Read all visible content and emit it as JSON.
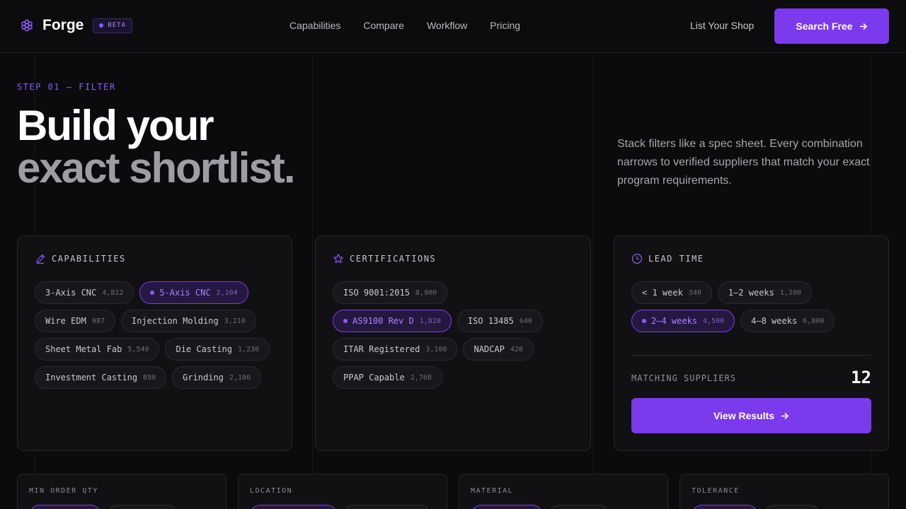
{
  "nav": {
    "brand": "Forge",
    "badge": "BETA",
    "links": [
      "Capabilities",
      "Compare",
      "Workflow",
      "Pricing"
    ],
    "list_shop": "List Your Shop",
    "search_btn": "Search Free"
  },
  "hero": {
    "eyebrow": "STEP 01 — FILTER",
    "title_line1": "Build your",
    "title_line2": "exact shortlist.",
    "description": "Stack filters like a spec sheet. Every combination narrows to verified suppliers that match your exact program requirements."
  },
  "capabilities": {
    "title": "CAPABILITIES",
    "chips": [
      {
        "label": "3-Axis CNC",
        "count": "4,812",
        "active": false
      },
      {
        "label": "5-Axis CNC",
        "count": "2,104",
        "active": true
      },
      {
        "label": "Wire EDM",
        "count": "987",
        "active": false
      },
      {
        "label": "Injection Molding",
        "count": "3,210",
        "active": false
      },
      {
        "label": "Sheet Metal Fab",
        "count": "5,540",
        "active": false
      },
      {
        "label": "Die Casting",
        "count": "1,230",
        "active": false
      },
      {
        "label": "Investment Casting",
        "count": "890",
        "active": false
      },
      {
        "label": "Grinding",
        "count": "2,100",
        "active": false
      }
    ]
  },
  "certifications": {
    "title": "CERTIFICATIONS",
    "chips": [
      {
        "label": "ISO 9001:2015",
        "count": "8,900",
        "active": false
      },
      {
        "label": "AS9100 Rev D",
        "count": "1,820",
        "active": true
      },
      {
        "label": "ISO 13485",
        "count": "640",
        "active": false
      },
      {
        "label": "ITAR Registered",
        "count": "3,100",
        "active": false
      },
      {
        "label": "NADCAP",
        "count": "420",
        "active": false
      },
      {
        "label": "PPAP Capable",
        "count": "2,760",
        "active": false
      }
    ]
  },
  "lead_time": {
    "title": "LEAD TIME",
    "chips": [
      {
        "label": "< 1 week",
        "count": "340",
        "active": false
      },
      {
        "label": "1–2 weeks",
        "count": "1,200",
        "active": false
      },
      {
        "label": "2–4 weeks",
        "count": "4,500",
        "active": true
      },
      {
        "label": "4–8 weeks",
        "count": "6,800",
        "active": false
      }
    ],
    "matching_label": "MATCHING SUPPLIERS",
    "matching_count": "12",
    "view_btn": "View Results"
  },
  "bottom": {
    "min_order": "MIN ORDER QTY",
    "location": "LOCATION",
    "material": "MATERIAL",
    "tolerance": "TOLERANCE"
  },
  "colors": {
    "accent": "#7c3aed",
    "accent_text": "#a884ff",
    "background": "#0b0b0d"
  }
}
